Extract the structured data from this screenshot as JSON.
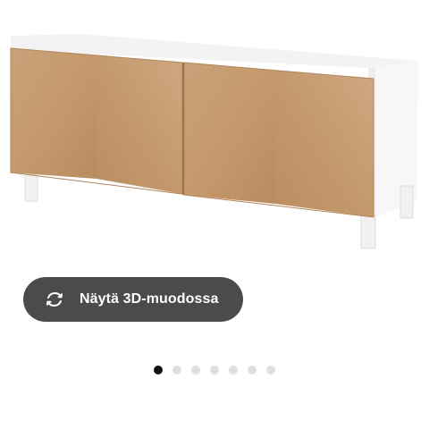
{
  "view_3d_button": {
    "label": "Näytä 3D-muodossa",
    "icon": "rotate-3d-icon"
  },
  "product": {
    "image": "sideboard-with-herringbone-oak-doors"
  },
  "carousel": {
    "total_slides": 7,
    "active_index": 0
  },
  "colors": {
    "button_background": "#4b4b4b",
    "active_dot": "#111111",
    "inactive_dot": "#dfdfdf",
    "wood": "#c39a6c",
    "cabinet_frame": "#f4f4f4"
  }
}
